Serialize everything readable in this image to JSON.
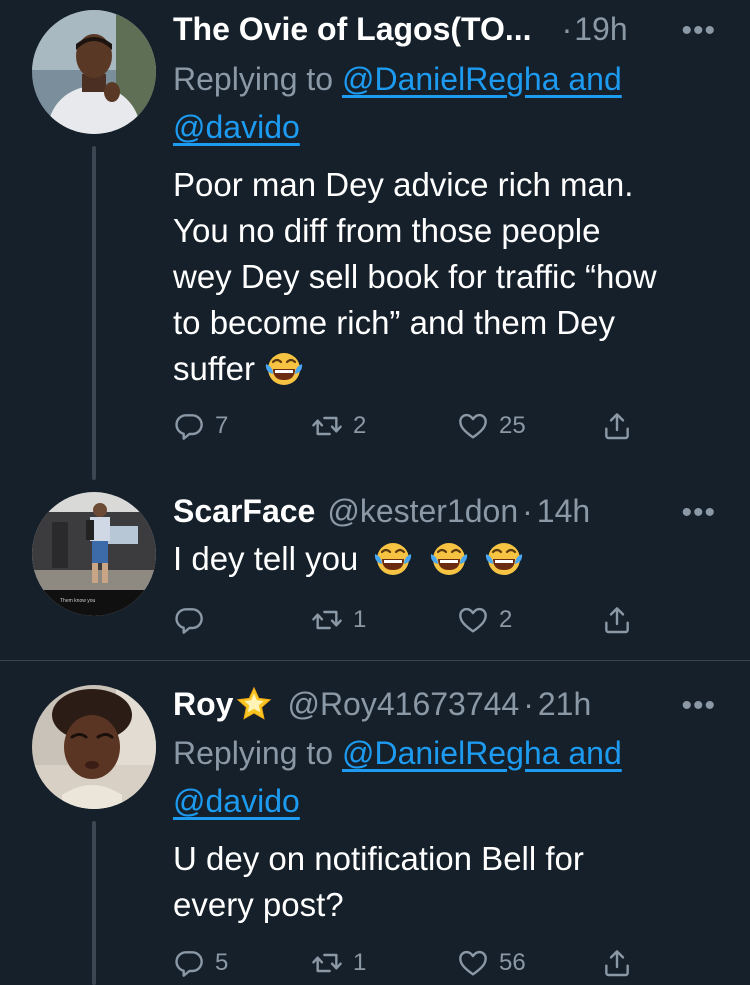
{
  "tweets": [
    {
      "name": "The Ovie of Lagos(TO...",
      "time": "19h",
      "replying_prefix": "Replying to",
      "mention_1": "@DanielRegha and",
      "mention_2": "@davido",
      "text_lines": [
        "Poor man Dey advice rich man.",
        "You no diff from those people",
        "wey Dey sell book for traffic “how",
        "to become rich” and them Dey",
        "suffer"
      ],
      "replies": "7",
      "retweets": "2",
      "likes": "25"
    },
    {
      "name": "ScarFace",
      "handle": "@kester1don",
      "time": "14h",
      "text": "I dey tell you",
      "avatar_caption": "Them know you",
      "replies": "",
      "retweets": "1",
      "likes": "2"
    },
    {
      "name": "Roy",
      "handle": "@Roy41673744",
      "time": "21h",
      "replying_prefix": "Replying to",
      "mention_1": "@DanielRegha and",
      "mention_2": "@davido",
      "text_lines": [
        "U dey on notification Bell for",
        "every post?"
      ],
      "replies": "5",
      "retweets": "1",
      "likes": "56"
    }
  ],
  "ui": {
    "more_glyph": "•••",
    "dot": "·"
  },
  "colors": {
    "background": "#15202b",
    "link": "#1d9bf0",
    "muted": "#8b98a5"
  },
  "icons": [
    "reply-icon",
    "retweet-icon",
    "like-icon",
    "share-icon",
    "more-icon",
    "tears-of-joy-emoji",
    "glowing-star-emoji"
  ]
}
